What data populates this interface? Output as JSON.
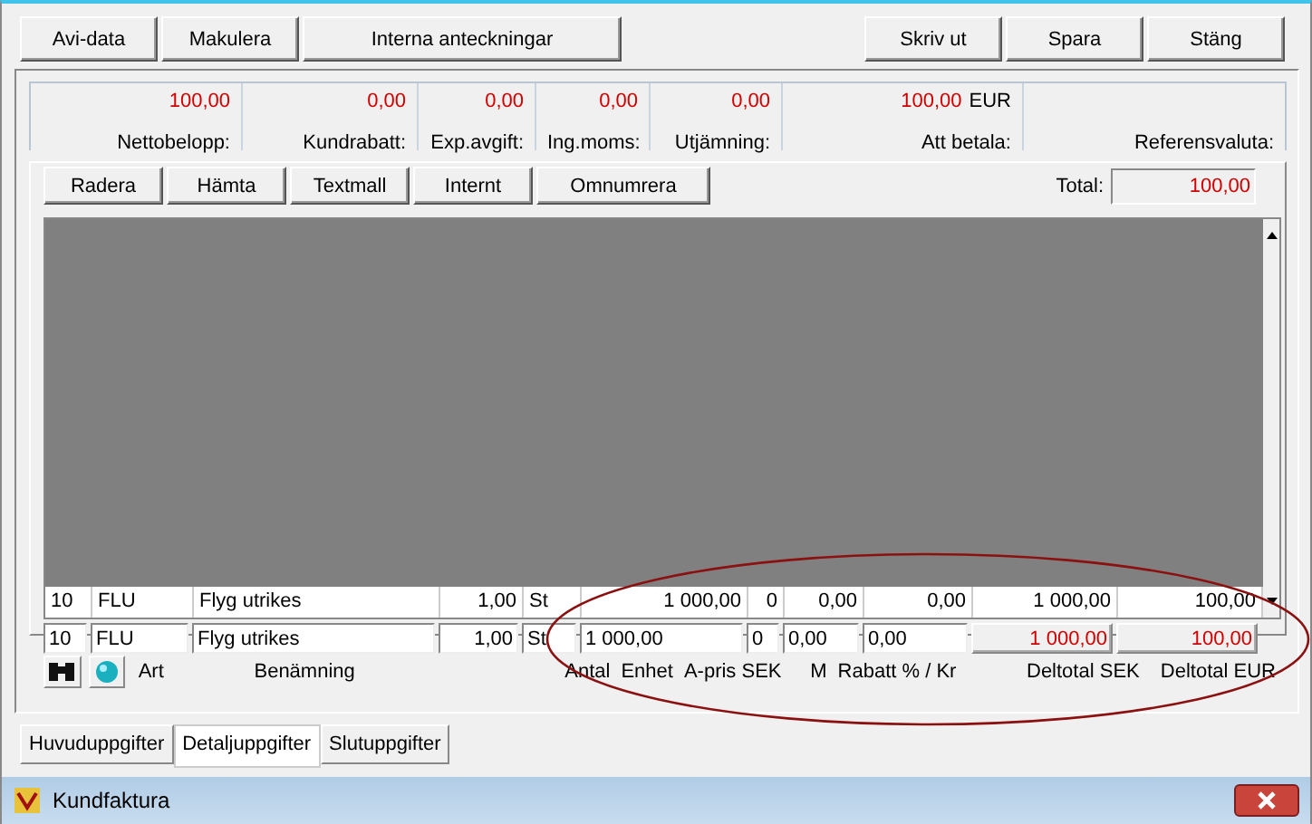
{
  "toolbar": {
    "left_buttons": [
      "Avi-data",
      "Makulera",
      "Interna anteckningar"
    ],
    "right_buttons": [
      "Skriv ut",
      "Spara",
      "Stäng"
    ]
  },
  "summary": [
    {
      "label": "Nettobelopp:",
      "value": "100,00"
    },
    {
      "label": "Kundrabatt:",
      "value": "0,00"
    },
    {
      "label": "Exp.avgift:",
      "value": "0,00"
    },
    {
      "label": "Ing.moms:",
      "value": "0,00"
    },
    {
      "label": "Utjämning:",
      "value": "0,00"
    },
    {
      "label": "Att betala:",
      "value": "100,00",
      "unit": "EUR"
    },
    {
      "label": "Referensvaluta:"
    }
  ],
  "row_buttons": [
    "Radera",
    "Hämta",
    "Textmall",
    "Internt",
    "Omnumrera"
  ],
  "total": {
    "label": "Total:",
    "value": "100,00"
  },
  "grid_row": [
    "10",
    "FLU",
    "Flyg utrikes",
    "1,00",
    "St",
    "1 000,00",
    "0",
    "0,00",
    "0,00",
    "1 000,00",
    "100,00"
  ],
  "edit_row": [
    {
      "value": "10",
      "kind": "input"
    },
    {
      "value": "FLU",
      "kind": "input"
    },
    {
      "value": "Flyg utrikes",
      "kind": "input"
    },
    {
      "value": "1,00",
      "kind": "input"
    },
    {
      "value": "St",
      "kind": "input"
    },
    {
      "value": "1 000,00",
      "kind": "input"
    },
    {
      "value": "0",
      "kind": "input"
    },
    {
      "value": "0,00",
      "kind": "input"
    },
    {
      "value": "0,00",
      "kind": "input"
    },
    {
      "value": "1 000,00",
      "kind": "total"
    },
    {
      "value": "100,00",
      "kind": "total"
    }
  ],
  "column_labels": [
    "Art",
    "Benämning",
    "Antal",
    "Enhet",
    "A-pris SEK",
    "M",
    "Rabatt % / Kr",
    "Deltotal SEK",
    "Deltotal EUR"
  ],
  "tabs": [
    {
      "label": "Huvuduppgifter",
      "selected": false
    },
    {
      "label": "Detaljuppgifter",
      "selected": true
    },
    {
      "label": "Slutuppgifter",
      "selected": false
    }
  ],
  "window": {
    "title": "Kundfaktura"
  }
}
